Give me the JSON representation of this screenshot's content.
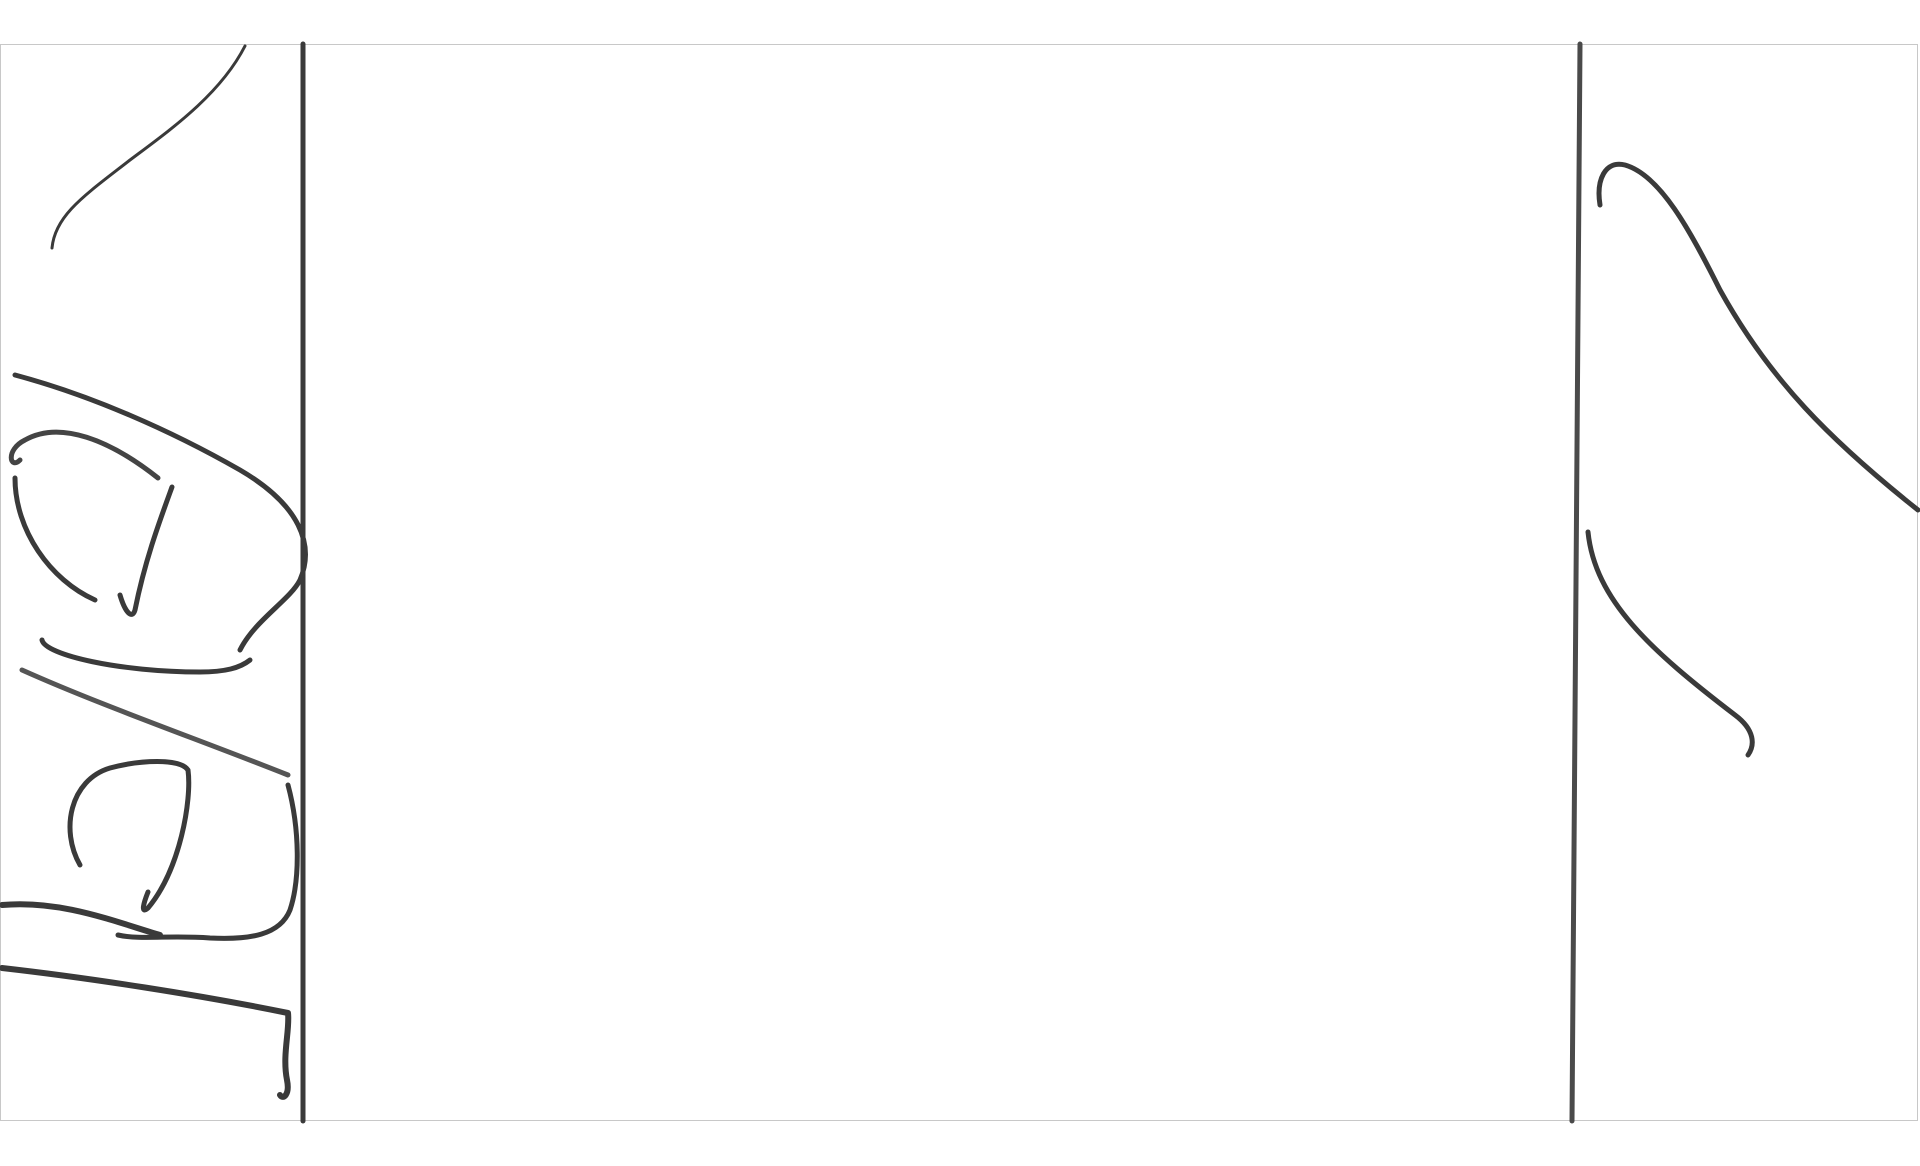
{
  "canvas": {
    "background_color": "#ffffff",
    "frame_border_color": "#c8c8c8"
  },
  "ink": {
    "stroke_color": "#3a3a3a",
    "light_stroke_color": "#5a5a5a"
  },
  "icons": {
    "left_sketch": "handwritten-scribble-icon",
    "right_sketch": "curve-strokes-icon"
  }
}
